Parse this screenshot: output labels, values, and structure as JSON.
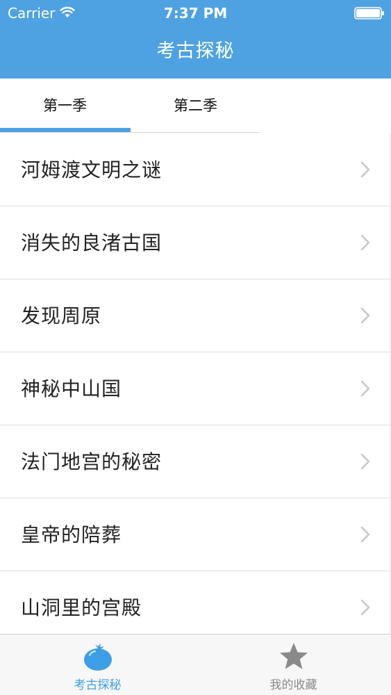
{
  "status_bar": {
    "carrier": "Carrier",
    "time": "7:37 PM",
    "wifi_icon": "wifi-icon",
    "battery_icon": "battery-icon"
  },
  "nav": {
    "title": "考古探秘"
  },
  "tabs": [
    {
      "label": "第一季",
      "selected": true
    },
    {
      "label": "第二季",
      "selected": false
    }
  ],
  "list": {
    "items": [
      {
        "label": "河姆渡文明之谜"
      },
      {
        "label": "消失的良渚古国"
      },
      {
        "label": "发现周原"
      },
      {
        "label": "神秘中山国"
      },
      {
        "label": "法门地宫的秘密"
      },
      {
        "label": "皇帝的陪葬"
      },
      {
        "label": "山洞里的宫殿"
      }
    ],
    "chevron_icon": "chevron-right-icon"
  },
  "tab_bar": {
    "items": [
      {
        "label": "考古探秘",
        "icon": "tomato-icon",
        "active": true
      },
      {
        "label": "我的收藏",
        "icon": "star-icon",
        "active": false
      }
    ]
  },
  "colors": {
    "accent": "#4fa2e2",
    "tabbar_active": "#3da0e6",
    "tabbar_inactive": "#8a8a8a"
  }
}
